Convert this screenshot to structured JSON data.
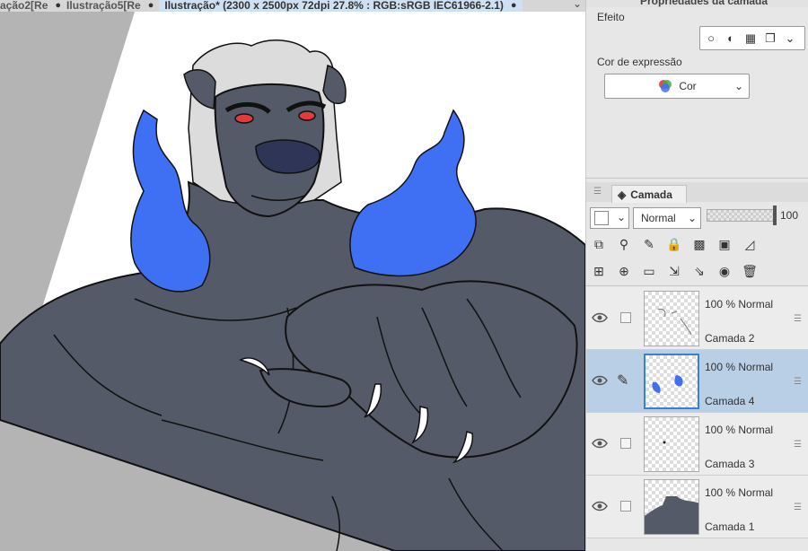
{
  "document_tabs": [
    {
      "label": "ação2[Re",
      "active": false
    },
    {
      "label": "Ilustração5[Re",
      "active": false
    },
    {
      "label": "Ilustração* (2300 x 2500px 72dpi 27.8% : RGB:sRGB IEC61966-2.1)",
      "active": true
    }
  ],
  "tab_close_dot": "●",
  "panel_title": "Propriedades da camada",
  "efeito": {
    "label": "Efeito"
  },
  "cor_expressao": {
    "label": "Cor de expressão",
    "value": "Cor"
  },
  "camada_panel": {
    "tab_label": "Camada",
    "blend_mode": "Normal",
    "opacity": "100",
    "layers": [
      {
        "mode": "100 % Normal",
        "name": "Camada 2",
        "selected": false
      },
      {
        "mode": "100 % Normal",
        "name": "Camada 4",
        "selected": true
      },
      {
        "mode": "100 % Normal",
        "name": "Camada 3",
        "selected": false
      },
      {
        "mode": "100 % Normal",
        "name": "Camada 1",
        "selected": false
      }
    ]
  },
  "colors": {
    "fur": "#555a69",
    "fire": "#3f6ff2",
    "mane": "#dcdcdc",
    "selection": "#b8cfe6",
    "accent": "#3a7fd5"
  }
}
